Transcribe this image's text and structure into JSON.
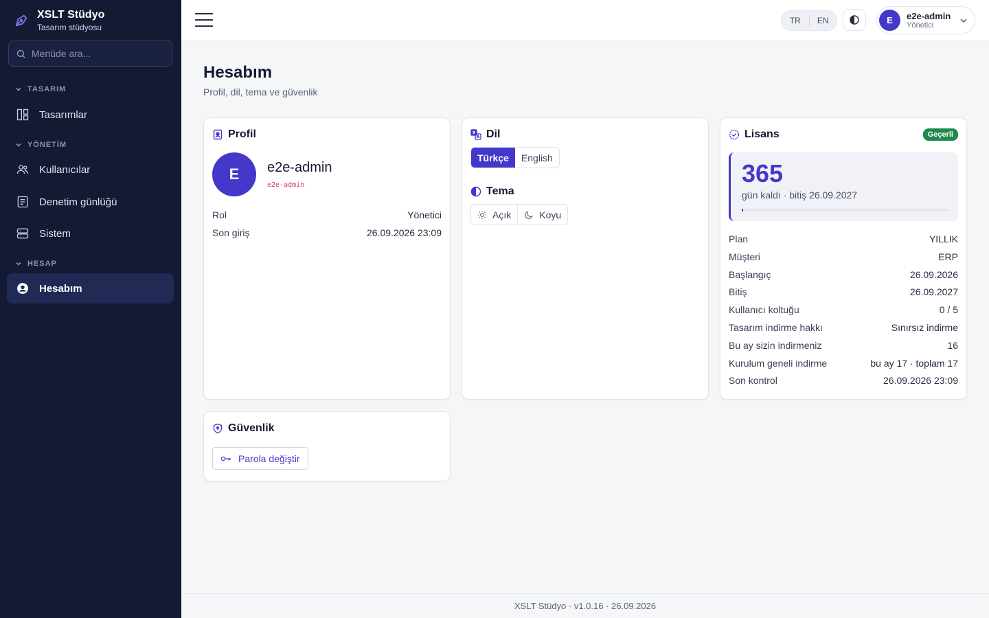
{
  "brand": {
    "name": "XSLT Stüdyo",
    "subtitle": "Tasarım stüdyosu"
  },
  "sidebar": {
    "search_placeholder": "Menüde ara...",
    "sections": [
      {
        "title": "TASARIM",
        "items": [
          {
            "label": "Tasarımlar",
            "icon": "layout-icon"
          }
        ]
      },
      {
        "title": "YÖNETİM",
        "items": [
          {
            "label": "Kullanıcılar",
            "icon": "users-icon"
          },
          {
            "label": "Denetim günlüğü",
            "icon": "log-icon"
          },
          {
            "label": "Sistem",
            "icon": "server-icon"
          }
        ]
      },
      {
        "title": "HESAP",
        "items": [
          {
            "label": "Hesabım",
            "icon": "user-circle-icon",
            "active": true
          }
        ]
      }
    ]
  },
  "topbar": {
    "languages": [
      "TR",
      "EN"
    ],
    "user": {
      "initial": "E",
      "name": "e2e-admin",
      "role": "Yönetici"
    }
  },
  "page": {
    "title": "Hesabım",
    "subtitle": "Profil, dil, tema ve güvenlik"
  },
  "profile": {
    "title": "Profil",
    "initial": "E",
    "name": "e2e-admin",
    "handle": "e2e-admin",
    "rows": [
      {
        "key": "Rol",
        "value": "Yönetici"
      },
      {
        "key": "Son giriş",
        "value": "26.09.2026 23:09"
      }
    ]
  },
  "language": {
    "title": "Dil",
    "options": [
      "Türkçe",
      "English"
    ],
    "selected": "Türkçe"
  },
  "theme": {
    "title": "Tema",
    "options": [
      "Açık",
      "Koyu"
    ]
  },
  "license": {
    "title": "Lisans",
    "status": "Geçerli",
    "days": "365",
    "days_sub": "gün kaldı · bitiş 26.09.2027",
    "progress_fraction": 0.005,
    "rows": [
      {
        "key": "Plan",
        "value": "YILLIK"
      },
      {
        "key": "Müşteri",
        "value": "ERP"
      },
      {
        "key": "Başlangıç",
        "value": "26.09.2026"
      },
      {
        "key": "Bitiş",
        "value": "26.09.2027"
      },
      {
        "key": "Kullanıcı koltuğu",
        "value": "0 / 5"
      },
      {
        "key": "Tasarım indirme hakkı",
        "value": "Sınırsız indirme"
      },
      {
        "key": "Bu ay sizin indirmeniz",
        "value": "16"
      },
      {
        "key": "Kurulum geneli indirme",
        "value": "bu ay 17 · toplam 17"
      },
      {
        "key": "Son kontrol",
        "value": "26.09.2026 23:09"
      }
    ]
  },
  "security": {
    "title": "Güvenlik",
    "change_password": "Parola değiştir"
  },
  "footer": {
    "text": "XSLT Stüdyo · v1.0.16 · 26.09.2026"
  },
  "colors": {
    "accent": "#4338ca",
    "sidebar_bg": "#141a33",
    "badge_green": "#1f8a4c"
  }
}
